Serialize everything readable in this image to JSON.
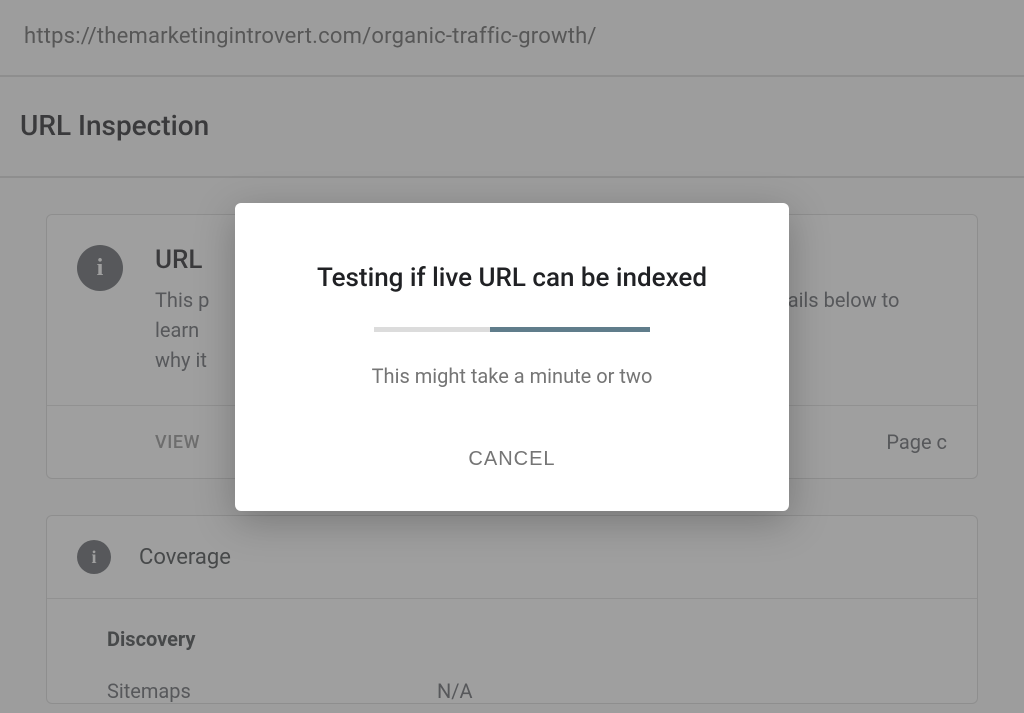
{
  "url_bar": "https://themarketingintrovert.com/organic-traffic-growth/",
  "page_title": "URL Inspection",
  "status_card": {
    "title_visible_prefix": "URL",
    "desc_line1_prefix": "This p",
    "desc_line2_prefix": "why it",
    "desc_right_fragment": "details below to learn",
    "view_action_prefix": "VIEW",
    "page_action_prefix": "Page c"
  },
  "coverage_card": {
    "label": "Coverage",
    "discovery_heading": "Discovery",
    "sitemaps_label": "Sitemaps",
    "sitemaps_value": "N/A"
  },
  "dialog": {
    "title": "Testing if live URL can be indexed",
    "subtitle": "This might take a minute or two",
    "cancel": "CANCEL"
  }
}
